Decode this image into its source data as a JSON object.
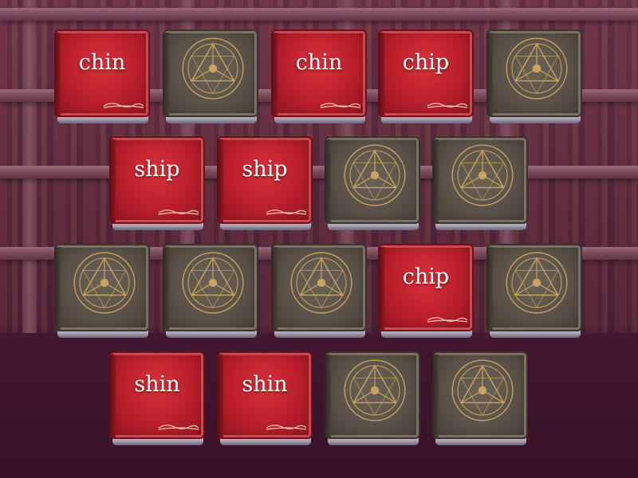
{
  "game": {
    "colors": {
      "revealed_cover": "#b81f2a",
      "hidden_cover": "#5a5248",
      "emblem_gold": "#c9a460",
      "word_text": "#ffffff"
    },
    "cards": [
      {
        "state": "revealed",
        "word": "chin"
      },
      {
        "state": "hidden",
        "icon": "magic-circle-icon"
      },
      {
        "state": "revealed",
        "word": "chin"
      },
      {
        "state": "revealed",
        "word": "chip"
      },
      {
        "state": "hidden",
        "icon": "magic-circle-icon"
      },
      {
        "state": "revealed",
        "word": "ship"
      },
      {
        "state": "revealed",
        "word": "ship"
      },
      {
        "state": "hidden",
        "icon": "magic-circle-icon"
      },
      {
        "state": "hidden",
        "icon": "magic-circle-icon"
      },
      {
        "state": "hidden",
        "icon": "magic-circle-icon"
      },
      {
        "state": "hidden",
        "icon": "magic-circle-icon"
      },
      {
        "state": "hidden",
        "icon": "magic-circle-icon"
      },
      {
        "state": "revealed",
        "word": "chip"
      },
      {
        "state": "hidden",
        "icon": "magic-circle-icon"
      },
      {
        "state": "revealed",
        "word": "shin"
      },
      {
        "state": "revealed",
        "word": "shin"
      },
      {
        "state": "hidden",
        "icon": "magic-circle-icon"
      },
      {
        "state": "hidden",
        "icon": "magic-circle-icon"
      }
    ]
  }
}
